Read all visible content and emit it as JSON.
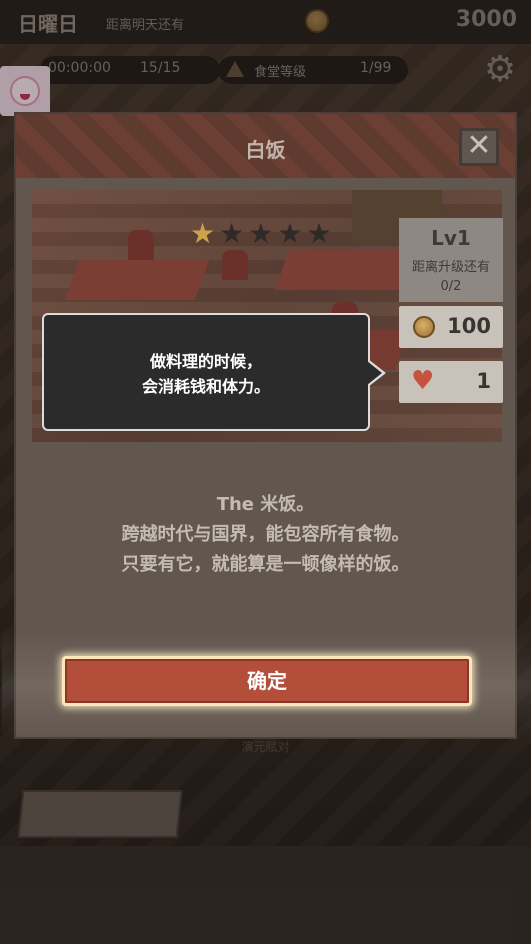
{
  "hud": {
    "day": "日曜日",
    "countdown_label": "距离明天还有",
    "money": "3000",
    "timer": "00:00:00",
    "count": "15/15",
    "level_label": "食堂等级",
    "level_value": "1/99"
  },
  "dialog": {
    "title": "白饭",
    "stars_filled": 1,
    "stars_total": 5,
    "level": "Lv1",
    "upgrade_label": "距离升级还有",
    "upgrade_progress": "0/2",
    "cost_coin": "100",
    "cost_heart": "1",
    "tooltip_line1": "做料理的时候，",
    "tooltip_line2": "会消耗钱和体力。",
    "desc_line1": "The 米饭。",
    "desc_line2": "跨越时代与国界，能包容所有食物。",
    "desc_line3": "只要有它，就能算是一顿像样的饭。",
    "confirm_label": "确定"
  },
  "background": {
    "bottom_text": "演元赋对"
  },
  "icons": {
    "settings": "gear-icon",
    "close": "close-icon",
    "coin": "coin-icon",
    "heart": "heart-icon",
    "star": "star-icon"
  },
  "colors": {
    "confirm": "#b24e3a",
    "star_on": "#c9a44a",
    "heart": "#c6523f"
  }
}
